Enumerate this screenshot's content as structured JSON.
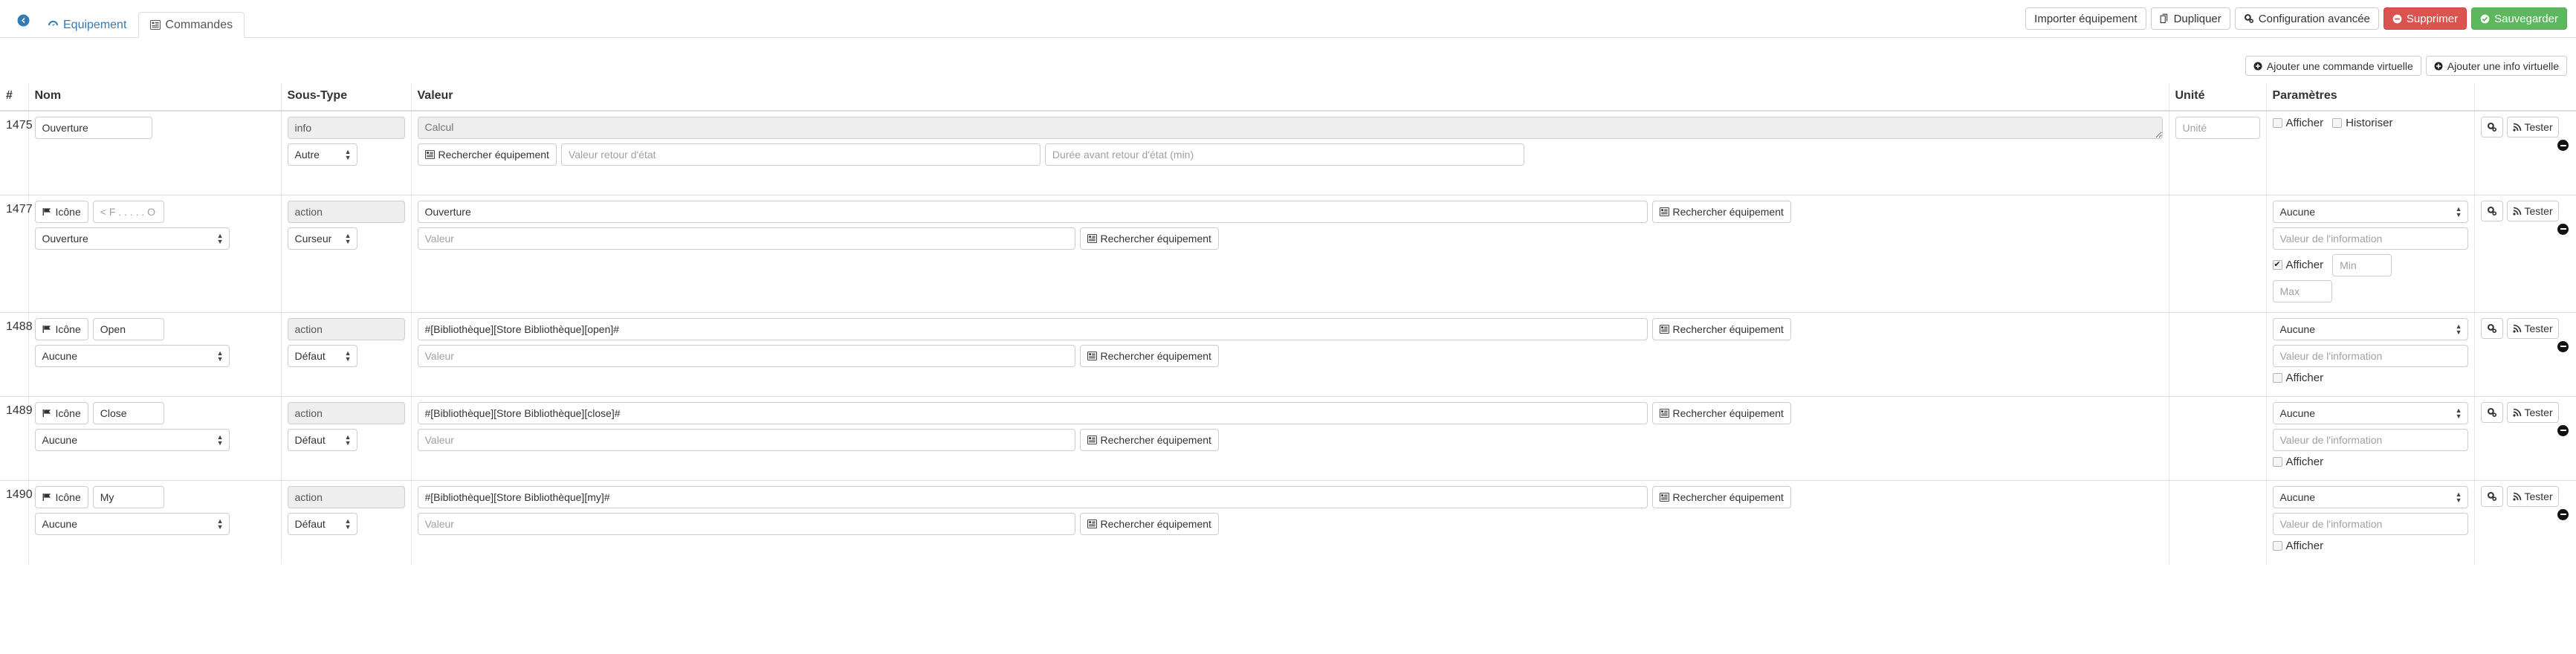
{
  "tabs": [
    {
      "label": "Equipement",
      "icon": "dashboard-icon",
      "active": false
    },
    {
      "label": "Commandes",
      "icon": "list-icon",
      "active": true
    }
  ],
  "back_icon": "back-arrow-icon",
  "toolbar": {
    "import_label": "Importer équipement",
    "duplicate_label": "Dupliquer",
    "advanced_label": "Configuration avancée",
    "delete_label": "Supprimer",
    "save_label": "Sauvegarder",
    "delete_color": "#d9534f",
    "save_color": "#5cb85c"
  },
  "toolbar2": {
    "add_command_label": "Ajouter une commande virtuelle",
    "add_info_label": "Ajouter une info virtuelle"
  },
  "table": {
    "headers": {
      "id": "#",
      "nom": "Nom",
      "sous_type": "Sous-Type",
      "valeur": "Valeur",
      "unite": "Unité",
      "parametres": "Paramètres",
      "actions": ""
    },
    "common": {
      "search_equipment_label": "Rechercher équipement",
      "tester_label": "Tester",
      "afficher_label": "Afficher",
      "historiser_label": "Historiser",
      "icone_label": "Icône",
      "value_placeholder": "Valeur",
      "info_value_placeholder": "Valeur de l'information",
      "unite_placeholder": "Unité",
      "min_placeholder": "Min",
      "max_placeholder": "Max"
    },
    "rows": [
      {
        "id": "1475",
        "kind": "info",
        "name_value": "Ouverture",
        "type_badge": "info",
        "subtype_select": "Autre",
        "calc_placeholder": "Calcul",
        "search_equipment_label": "Rechercher équipement",
        "return_state_placeholder": "Valeur retour d'état",
        "return_delay_placeholder": "Durée avant retour d'état (min)",
        "unite_placeholder": "Unité",
        "afficher_label": "Afficher",
        "afficher_checked": false,
        "historiser_label": "Historiser",
        "historiser_checked": false,
        "tester_label": "Tester"
      },
      {
        "id": "1477",
        "kind": "action",
        "icone_label": "Icône",
        "name_placeholder": "< F . . . . . O >",
        "name_value": "",
        "icon_select": "Ouverture",
        "type_badge": "action",
        "subtype_select": "Curseur",
        "value_line1": "Ouverture",
        "value_line2_placeholder": "Valeur",
        "search_equipment_label": "Rechercher équipement",
        "param_select": "Aucune",
        "info_value_placeholder": "Valeur de l'information",
        "afficher_label": "Afficher",
        "afficher_checked": true,
        "min_placeholder": "Min",
        "max_placeholder": "Max",
        "tester_label": "Tester"
      },
      {
        "id": "1488",
        "kind": "action",
        "icone_label": "Icône",
        "name_value": "Open",
        "icon_select": "Aucune",
        "type_badge": "action",
        "subtype_select": "Défaut",
        "value_line1": "#[Bibliothèque][Store Bibliothèque][open]#",
        "value_line2_placeholder": "Valeur",
        "search_equipment_label": "Rechercher équipement",
        "param_select": "Aucune",
        "info_value_placeholder": "Valeur de l'information",
        "afficher_label": "Afficher",
        "afficher_checked": false,
        "tester_label": "Tester"
      },
      {
        "id": "1489",
        "kind": "action",
        "icone_label": "Icône",
        "name_value": "Close",
        "icon_select": "Aucune",
        "type_badge": "action",
        "subtype_select": "Défaut",
        "value_line1": "#[Bibliothèque][Store Bibliothèque][close]#",
        "value_line2_placeholder": "Valeur",
        "search_equipment_label": "Rechercher équipement",
        "param_select": "Aucune",
        "info_value_placeholder": "Valeur de l'information",
        "afficher_label": "Afficher",
        "afficher_checked": false,
        "tester_label": "Tester"
      },
      {
        "id": "1490",
        "kind": "action",
        "icone_label": "Icône",
        "name_value": "My",
        "icon_select": "Aucune",
        "type_badge": "action",
        "subtype_select": "Défaut",
        "value_line1": "#[Bibliothèque][Store Bibliothèque][my]#",
        "value_line2_placeholder": "Valeur",
        "search_equipment_label": "Rechercher équipement",
        "param_select": "Aucune",
        "info_value_placeholder": "Valeur de l'information",
        "afficher_label": "Afficher",
        "afficher_checked": false,
        "tester_label": "Tester"
      }
    ]
  }
}
